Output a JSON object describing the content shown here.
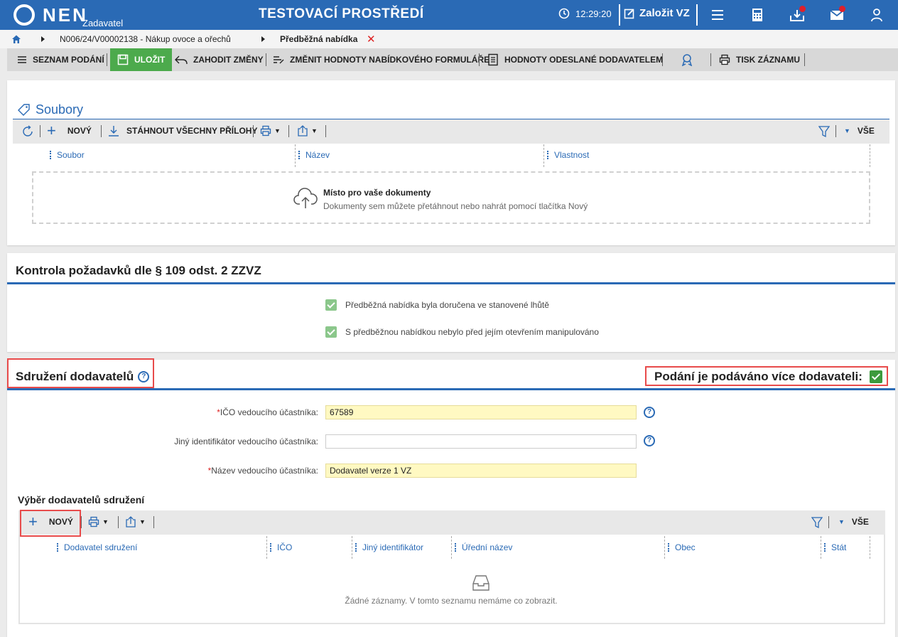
{
  "header": {
    "logo": "NEN",
    "logo_sub": "Zadavatel",
    "environment_title": "TESTOVACÍ PROSTŘEDÍ",
    "time": "12:29:20",
    "create_vz_label": "Založit VZ",
    "brand_color": "#2a6ab5"
  },
  "breadcrumb": {
    "items": [
      "N006/24/V00002138 - Nákup ovoce a ořechů",
      "Předběžná nabídka"
    ]
  },
  "toolbar": {
    "list_label": "SEZNAM PODÁNÍ",
    "save_label": "ULOŽIT",
    "discard_label": "ZAHODIT ZMĚNY",
    "change_values_label": "ZMĚNIT HODNOTY NABÍDKOVÉHO FORMULÁŘE",
    "sent_values_label": "HODNOTY ODESLANÉ DODAVATELEM",
    "print_label": "TISK ZÁZNAMU"
  },
  "files": {
    "title": "Soubory",
    "new_label": "NOVÝ",
    "download_all_label": "STÁHNOUT VŠECHNY PŘÍLOHY",
    "filter_all_label": "VŠE",
    "columns": [
      "Soubor",
      "Název",
      "Vlastnost"
    ],
    "dropzone_title": "Místo pro vaše dokumenty",
    "dropzone_sub": "Dokumenty sem můžete přetáhnout nebo nahrát pomocí tlačítka Nový"
  },
  "check": {
    "title": "Kontrola požadavků dle § 109 odst. 2 ZZVZ",
    "items": [
      "Předběžná nabídka byla doručena ve stanovené lhůtě",
      "S předběžnou nabídkou nebylo před jejím otevřením manipulováno"
    ]
  },
  "association": {
    "title": "Sdružení dodavatelů",
    "multi_label": "Podání je podáváno více dodavateli:",
    "multi_checked": true,
    "fields": {
      "ico_label": "IČO vedoucího účastníka:",
      "ico_value": "67589",
      "other_id_label": "Jiný identifikátor vedoucího účastníka:",
      "other_id_value": "",
      "name_label": "Název vedoucího účastníka:",
      "name_value": "Dodavatel verze 1 VZ"
    },
    "selection_title": "Výběr dodavatelů sdružení",
    "new_label": "NOVÝ",
    "filter_all_label": "VŠE",
    "columns": [
      "Dodavatel sdružení",
      "IČO",
      "Jiný identifikátor",
      "Úřední název",
      "Obec",
      "Stát"
    ],
    "empty_message": "Žádné záznamy. V tomto seznamu nemáme co zobrazit."
  }
}
